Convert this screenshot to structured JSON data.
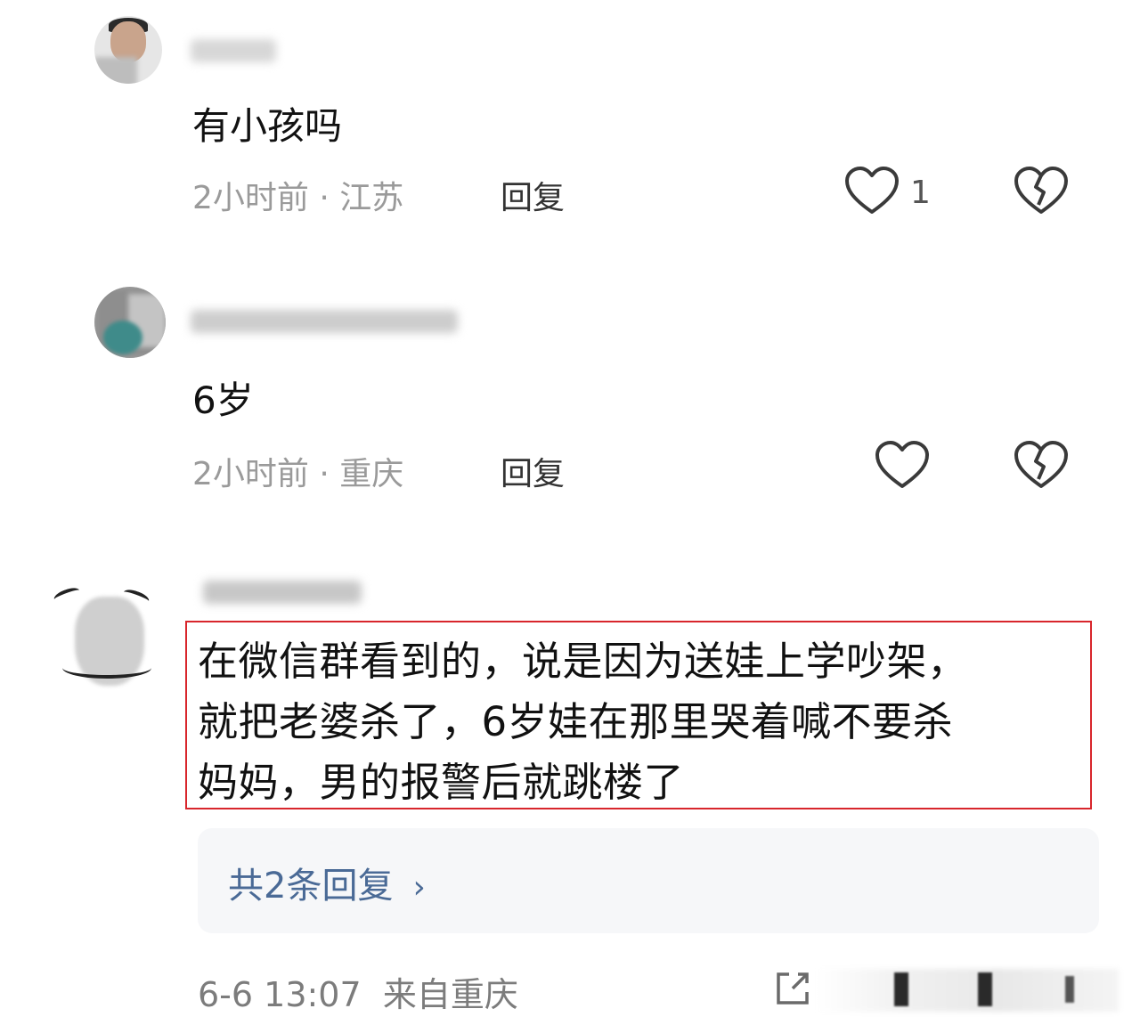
{
  "comments": [
    {
      "text": "有小孩吗",
      "time": "2小时前",
      "location": "江苏",
      "meta_sep": " · ",
      "reply_label": "回复",
      "like_count": "1"
    },
    {
      "text": "6岁",
      "time": "2小时前",
      "location": "重庆",
      "meta_sep": " · ",
      "reply_label": "回复"
    }
  ],
  "highlighted_comment": {
    "line1": "在微信群看到的，说是因为送娃上学吵架，",
    "line2": "就把老婆杀了，6岁娃在那里哭着喊不要杀",
    "line3": "妈妈，男的报警后就跳楼了",
    "replies_label": "共2条回复",
    "timestamp": "6-6 13:07",
    "source": "来自重庆"
  },
  "colors": {
    "highlight_border": "#d8262c",
    "reply_link": "#4a6a96",
    "meta": "#9a9a9a"
  },
  "icons": [
    "heart-outline-icon",
    "broken-heart-icon",
    "chevron-right-icon",
    "share-icon"
  ]
}
